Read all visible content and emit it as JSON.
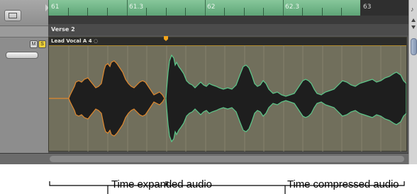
{
  "ruler": {
    "bars": [
      "61",
      "61.3",
      "62",
      "62.3",
      "63"
    ]
  },
  "markers": {
    "section": "Verse 2"
  },
  "track": {
    "mute_label": "M",
    "solo_label": "S"
  },
  "region": {
    "name": "Lead Vocal A 4 ◌"
  },
  "vscroll": {
    "note_glyph": "♪"
  },
  "captions": {
    "expanded": "Time expanded audio",
    "compressed": "Time compressed audio"
  },
  "colors": {
    "cycle_green": "#6bb584",
    "region_body": "#716f5c",
    "wave_fill": "#1e1e1e",
    "expanded_outline": "#e0882e",
    "compressed_outline": "#5cc88a",
    "flex_marker": "#f3a41a"
  }
}
